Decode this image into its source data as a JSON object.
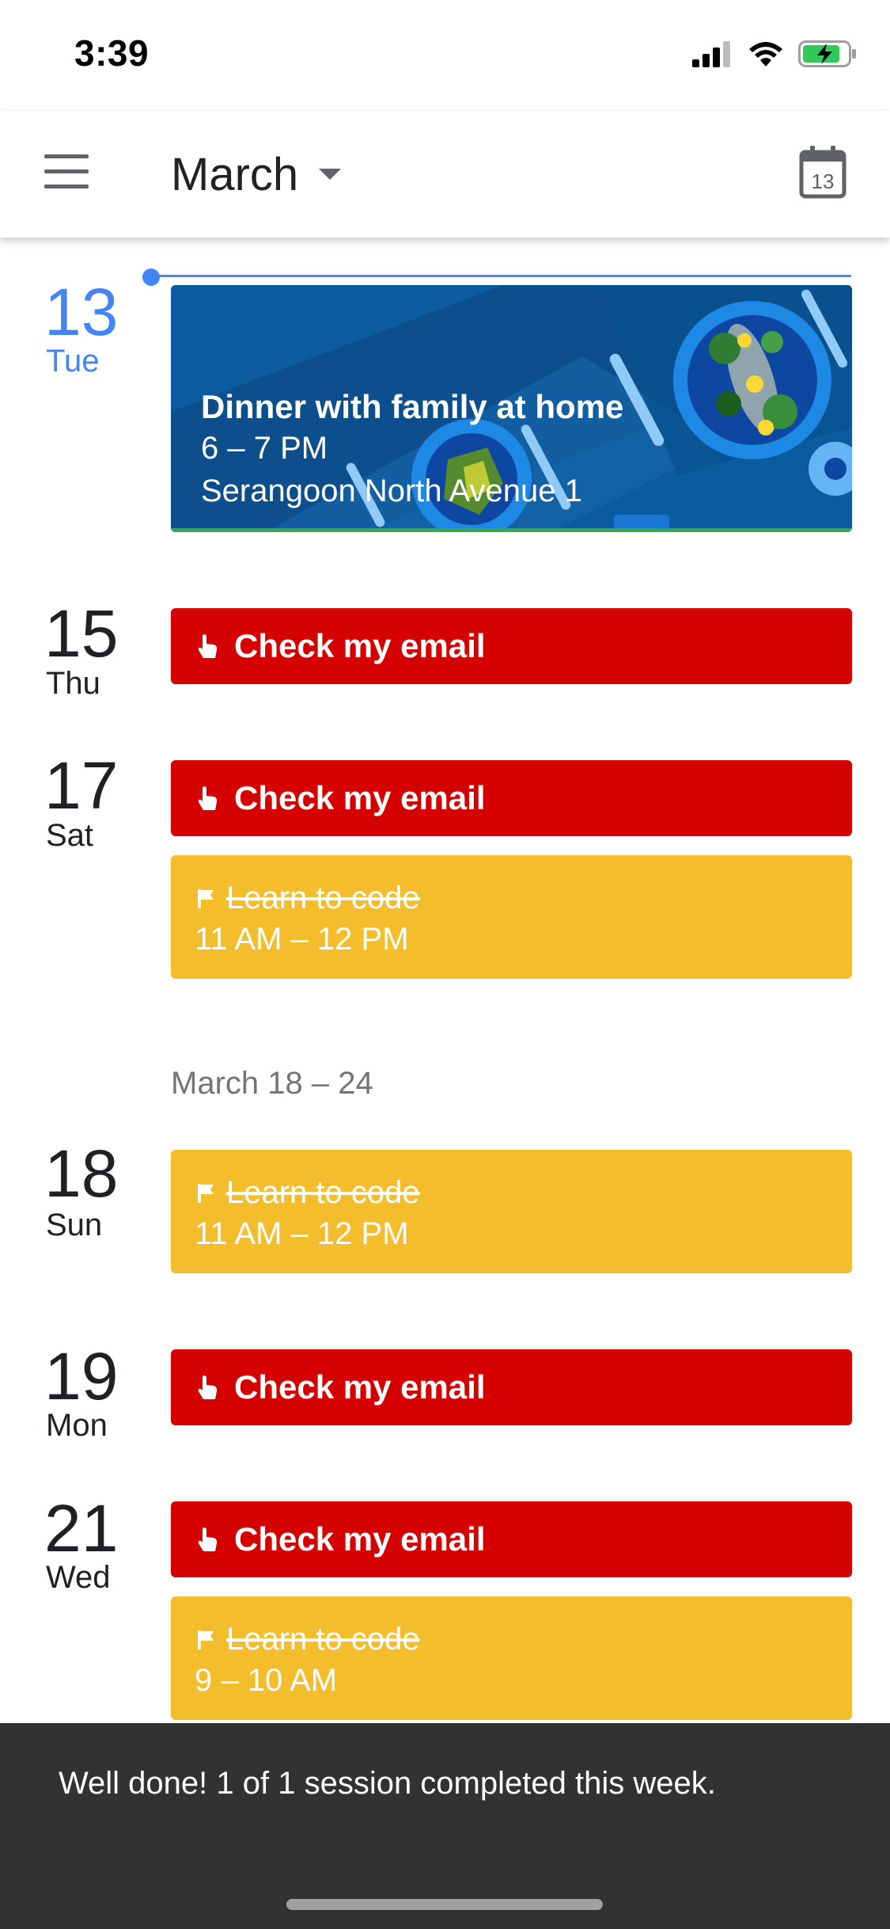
{
  "status_bar": {
    "time": "3:39"
  },
  "header": {
    "month": "March",
    "today_badge": "13"
  },
  "days": [
    {
      "num": "13",
      "name": "Tue"
    },
    {
      "num": "15",
      "name": "Thu"
    },
    {
      "num": "17",
      "name": "Sat"
    },
    {
      "num": "18",
      "name": "Sun"
    },
    {
      "num": "19",
      "name": "Mon"
    },
    {
      "num": "21",
      "name": "Wed"
    }
  ],
  "photo_event": {
    "title": "Dinner with family at home",
    "time": "6 – 7 PM",
    "location": "Serangoon North Avenue 1"
  },
  "events": [
    {
      "title": "Check my email"
    },
    {
      "title": "Check my email"
    },
    {
      "title": "Learn to code",
      "time": "11 AM – 12 PM"
    },
    {
      "title": "Learn to code",
      "time": "11 AM – 12 PM"
    },
    {
      "title": "Check my email"
    },
    {
      "title": "Check my email"
    },
    {
      "title": "Learn to code",
      "time": "9 – 10 AM"
    }
  ],
  "week_label": "March 18 – 24",
  "snackbar": {
    "text": "Well done! 1 of 1 session completed this week."
  },
  "colors": {
    "accent": "#4285f4",
    "event_red": "#d50000",
    "event_yellow": "#f4bd2c",
    "snackbar": "#323232"
  },
  "icons": {
    "menu": "menu-icon",
    "today": "calendar-today-icon",
    "task": "hand-tap-icon",
    "goal": "flag-icon"
  }
}
